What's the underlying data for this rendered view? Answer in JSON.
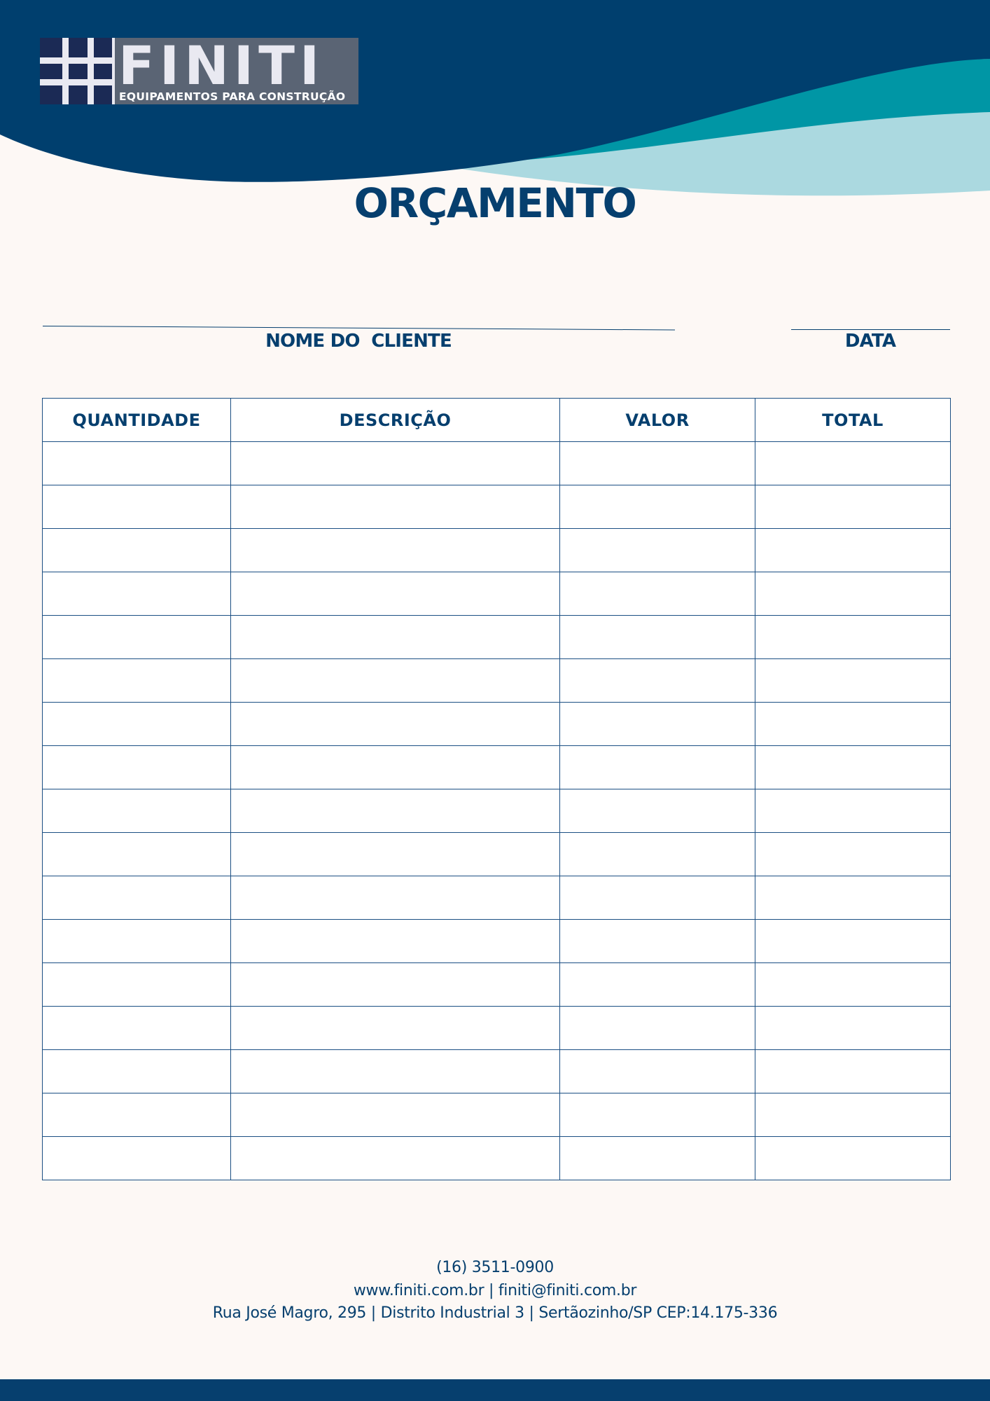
{
  "colors": {
    "navy": "#063f6e",
    "teal": "#0096a5",
    "light_teal": "#abd9e0",
    "paper": "#fdf8f5"
  },
  "logo": {
    "wordmark": "FINITI",
    "tagline": "EQUIPAMENTOS PARA CONSTRUÇÃO"
  },
  "document": {
    "title": "ORÇAMENTO"
  },
  "fields": {
    "client_label": "NOME DO  CLIENTE",
    "date_label": "DATA"
  },
  "table": {
    "headers": [
      "QUANTIDADE",
      "DESCRIÇÃO",
      "VALOR",
      "TOTAL"
    ],
    "rows": [
      [
        "",
        "",
        "",
        ""
      ],
      [
        "",
        "",
        "",
        ""
      ],
      [
        "",
        "",
        "",
        ""
      ],
      [
        "",
        "",
        "",
        ""
      ],
      [
        "",
        "",
        "",
        ""
      ],
      [
        "",
        "",
        "",
        ""
      ],
      [
        "",
        "",
        "",
        ""
      ],
      [
        "",
        "",
        "",
        ""
      ],
      [
        "",
        "",
        "",
        ""
      ],
      [
        "",
        "",
        "",
        ""
      ],
      [
        "",
        "",
        "",
        ""
      ],
      [
        "",
        "",
        "",
        ""
      ],
      [
        "",
        "",
        "",
        ""
      ],
      [
        "",
        "",
        "",
        ""
      ],
      [
        "",
        "",
        "",
        ""
      ],
      [
        "",
        "",
        "",
        ""
      ],
      [
        "",
        "",
        "",
        ""
      ]
    ]
  },
  "footer": {
    "phone": "(16) 3511-0900",
    "web_email": "www.finiti.com.br | finiti@finiti.com.br",
    "address": "Rua José Magro, 295 | Distrito Industrial 3 | Sertãozinho/SP CEP:14.175-336"
  }
}
